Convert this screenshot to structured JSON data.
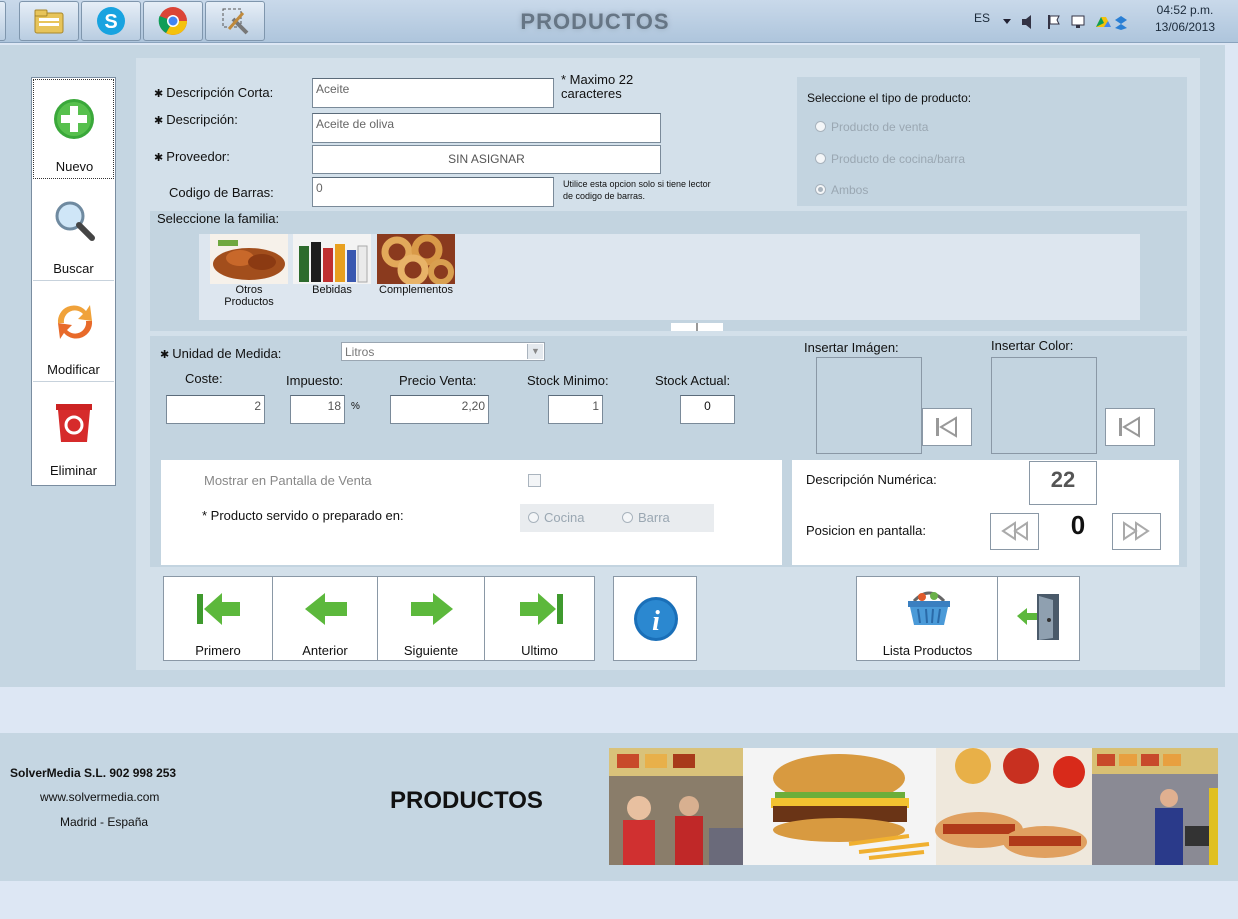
{
  "taskbar": {
    "title": "PRODUCTOS",
    "lang": "ES",
    "time": "04:52 p.m.",
    "date": "13/06/2013",
    "apps": [
      "file-explorer-icon",
      "skype-icon",
      "chrome-icon",
      "tools-icon"
    ]
  },
  "left_toolbar": {
    "nuevo": "Nuevo",
    "buscar": "Buscar",
    "modificar": "Modificar",
    "eliminar": "Eliminar"
  },
  "form": {
    "desc_corta_label": "Descripción Corta:",
    "desc_corta_value": "Aceite",
    "max_note_1": "* Maximo 22",
    "max_note_2": "caracteres",
    "desc_label": "Descripción:",
    "desc_value": "Aceite de oliva",
    "proveedor_label": "Proveedor:",
    "proveedor_value": "SIN ASIGNAR",
    "barcode_label": "Codigo de Barras:",
    "barcode_value": "0",
    "barcode_note_1": "Utilice esta opcion solo si tiene lector",
    "barcode_note_2": "de codigo de barras."
  },
  "product_type": {
    "title": "Seleccione el tipo de producto:",
    "options": [
      "Producto de venta",
      "Producto de cocina/barra",
      "Ambos"
    ],
    "selected": "Ambos"
  },
  "family": {
    "title": "Seleccione la familia:",
    "items": [
      "Otros Productos",
      "Bebidas",
      "Complementos"
    ]
  },
  "measures": {
    "unidad_label": "Unidad de  Medida:",
    "unidad_value": "Litros",
    "coste_label": "Coste:",
    "coste_value": "2",
    "impuesto_label": "Impuesto:",
    "impuesto_value": "18",
    "impuesto_unit": "%",
    "precio_label": "Precio Venta:",
    "precio_value": "2,20",
    "stock_min_label": "Stock Minimo:",
    "stock_min_value": "1",
    "stock_act_label": "Stock Actual:",
    "stock_act_value": "0",
    "insert_image_label": "Insertar Imágen:",
    "insert_color_label": "Insertar Color:"
  },
  "display": {
    "mostrar_label": "Mostrar en Pantalla de Venta",
    "servido_label": "* Producto servido o preparado en:",
    "servido_options": [
      "Cocina",
      "Barra"
    ],
    "desc_num_label": "Descripción Numérica:",
    "desc_num_value": "22",
    "posicion_label": "Posicion en pantalla:",
    "posicion_value": "0"
  },
  "nav": {
    "primero": "Primero",
    "anterior": "Anterior",
    "siguiente": "Siguiente",
    "ultimo": "Ultimo",
    "lista": "Lista Productos"
  },
  "footer": {
    "company": "SolverMedia S.L. 902 998 253",
    "web": "www.solvermedia.com",
    "city": "Madrid - España",
    "title": "PRODUCTOS"
  },
  "colors": {
    "frame": "#c5d6e2",
    "panel": "#d3e0ea",
    "accent_green": "#3aa83a"
  }
}
